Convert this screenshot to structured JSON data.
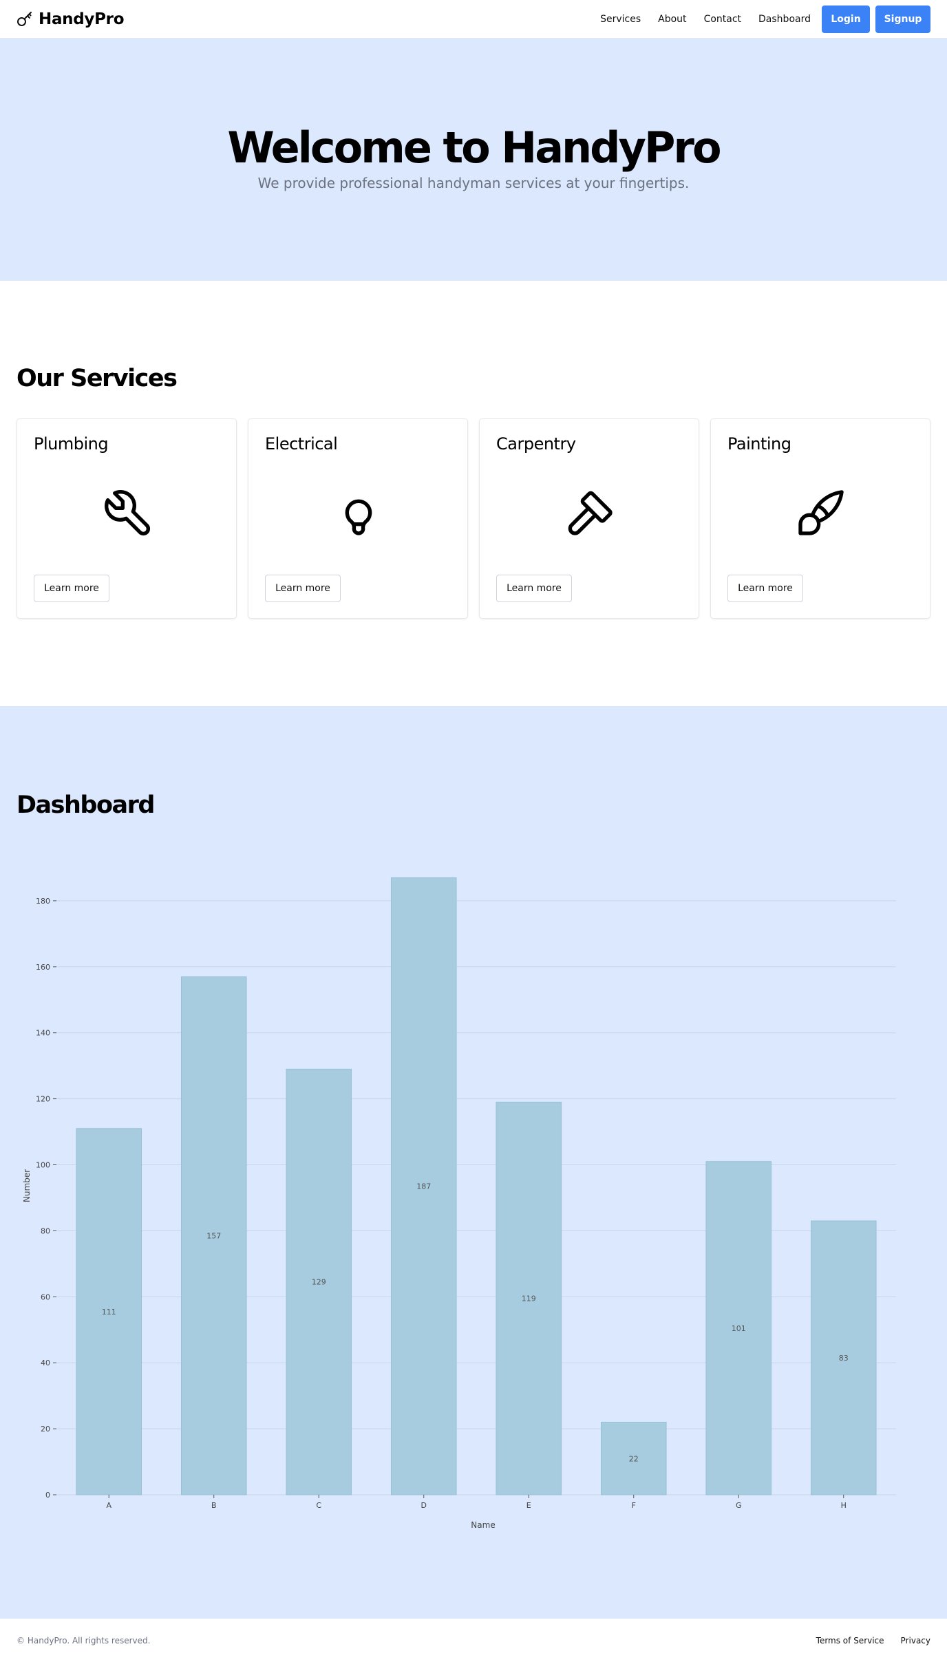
{
  "nav": {
    "brand": "HandyPro",
    "brand_icon": "key-icon",
    "links": [
      "Services",
      "About",
      "Contact",
      "Dashboard"
    ],
    "login_label": "Login",
    "signup_label": "Signup",
    "accent_color": "#3b82f6"
  },
  "hero": {
    "title": "Welcome to HandyPro",
    "subtitle": "We provide professional handyman services at your fingertips.",
    "background": "#dbe8fd"
  },
  "services": {
    "title": "Our Services",
    "cards": [
      {
        "title": "Plumbing",
        "icon": "wrench-icon",
        "button": "Learn more"
      },
      {
        "title": "Electrical",
        "icon": "lightbulb-icon",
        "button": "Learn more"
      },
      {
        "title": "Carpentry",
        "icon": "hammer-icon",
        "button": "Learn more"
      },
      {
        "title": "Painting",
        "icon": "paintbrush-icon",
        "button": "Learn more"
      }
    ]
  },
  "dashboard": {
    "title": "Dashboard"
  },
  "chart_data": {
    "type": "bar",
    "categories": [
      "A",
      "B",
      "C",
      "D",
      "E",
      "F",
      "G",
      "H"
    ],
    "values": [
      111,
      157,
      129,
      187,
      119,
      22,
      101,
      83
    ],
    "xlabel": "Name",
    "ylabel": "Number",
    "ylim": [
      0,
      180
    ],
    "yticks": [
      0,
      20,
      40,
      60,
      80,
      100,
      120,
      140,
      160,
      180
    ],
    "grid": true,
    "bar_color": "#a7cce0",
    "data_labels": true
  },
  "footer": {
    "copyright": "© HandyPro. All rights reserved.",
    "links": [
      "Terms of Service",
      "Privacy"
    ]
  }
}
